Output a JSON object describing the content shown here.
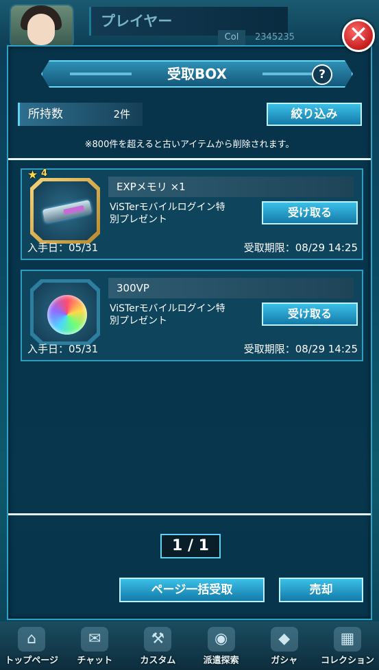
{
  "header": {
    "player_name": "プレイヤー",
    "col_label": "Col",
    "col_value": "2345235"
  },
  "modal": {
    "title": "受取BOX",
    "help_label": "?",
    "close_label": "✕",
    "count_label": "所持数",
    "count_value": "2件",
    "filter_label": "絞り込み",
    "notice": "※800件を超えると古いアイテムから削除されます。",
    "items": [
      {
        "name": "EXPメモリ ×1",
        "rarity": "4",
        "icon": "exp-memory-icon",
        "desc_line1": "ViSTerモバイルログイン特",
        "desc_line2": "別プレゼント",
        "receive_label": "受け取る",
        "got_date": "入手日：05/31",
        "expire": "受取期限：08/29 14:25"
      },
      {
        "name": "300VP",
        "icon": "vp-orb-icon",
        "desc_line1": "ViSTerモバイルログイン特",
        "desc_line2": "別プレゼント",
        "receive_label": "受け取る",
        "got_date": "入手日：05/31",
        "expire": "受取期限：08/29 14:25"
      }
    ],
    "pager": "1 / 1",
    "bulk_receive_label": "ページ一括受取",
    "sell_label": "売却"
  },
  "tabs": [
    {
      "label": "トップページ",
      "icon": "home-icon"
    },
    {
      "label": "チャット",
      "icon": "chat-icon"
    },
    {
      "label": "カスタム",
      "icon": "custom-icon"
    },
    {
      "label": "派遣探索",
      "icon": "explore-icon"
    },
    {
      "label": "ガシャ",
      "icon": "gacha-icon"
    },
    {
      "label": "コレクション",
      "icon": "collection-icon"
    }
  ]
}
